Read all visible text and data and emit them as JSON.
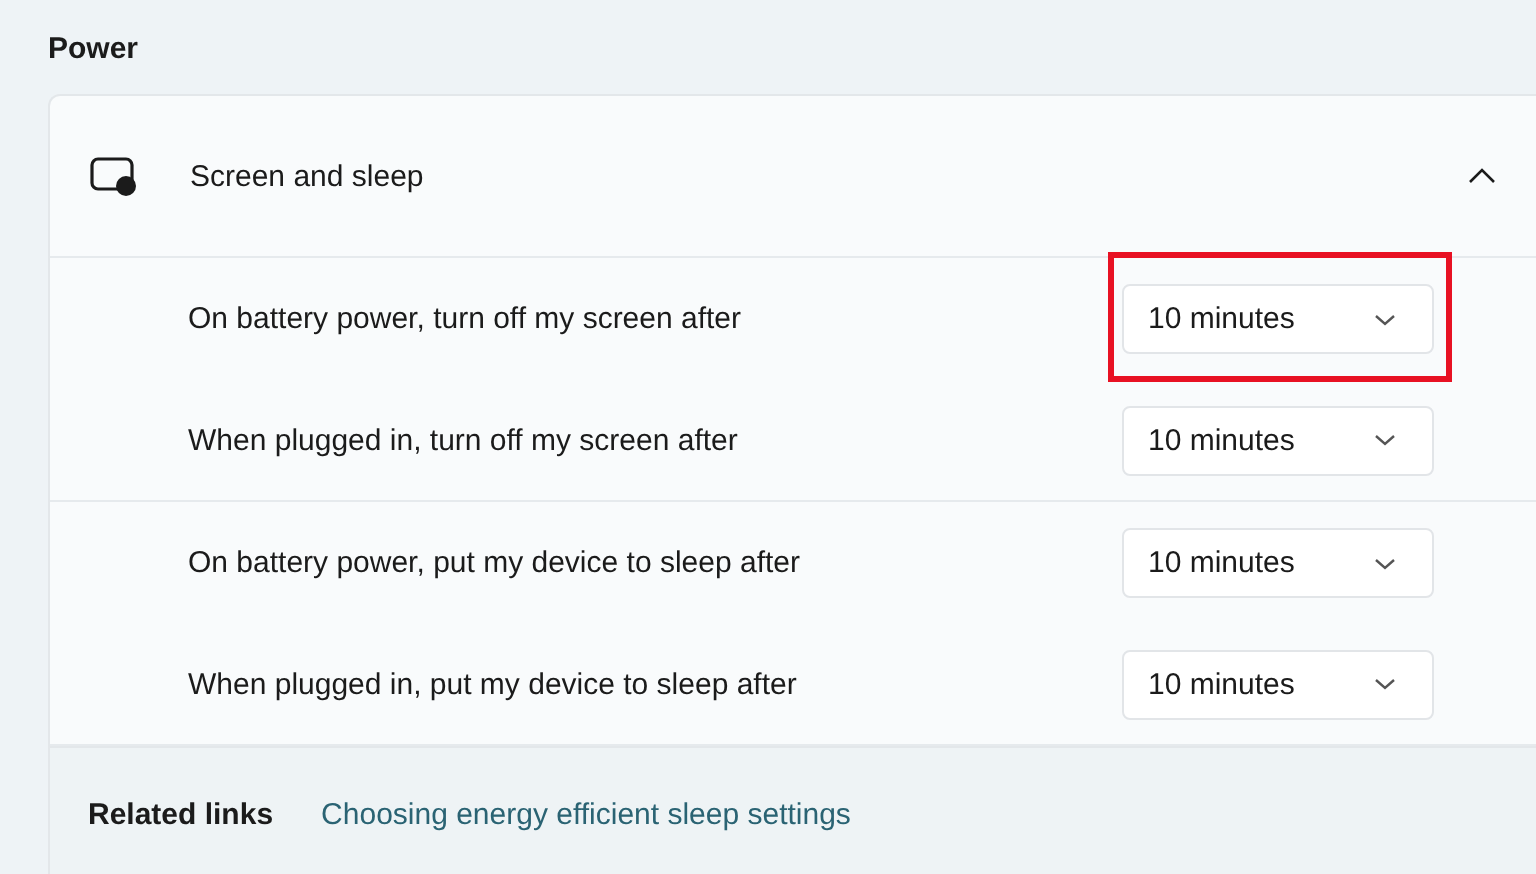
{
  "section_title": "Power",
  "group": {
    "title": "Screen and sleep",
    "expanded": true,
    "settings": [
      {
        "label": "On battery power, turn off my screen after",
        "value": "10 minutes",
        "highlighted": true,
        "divider_after": false
      },
      {
        "label": "When plugged in, turn off my screen after",
        "value": "10 minutes",
        "highlighted": false,
        "divider_after": true
      },
      {
        "label": "On battery power, put my device to sleep after",
        "value": "10 minutes",
        "highlighted": false,
        "divider_after": false
      },
      {
        "label": "When plugged in, put my device to sleep after",
        "value": "10 minutes",
        "highlighted": false,
        "divider_after": true
      }
    ]
  },
  "related_links": {
    "label": "Related links",
    "links": [
      "Choosing energy efficient sleep settings"
    ]
  }
}
